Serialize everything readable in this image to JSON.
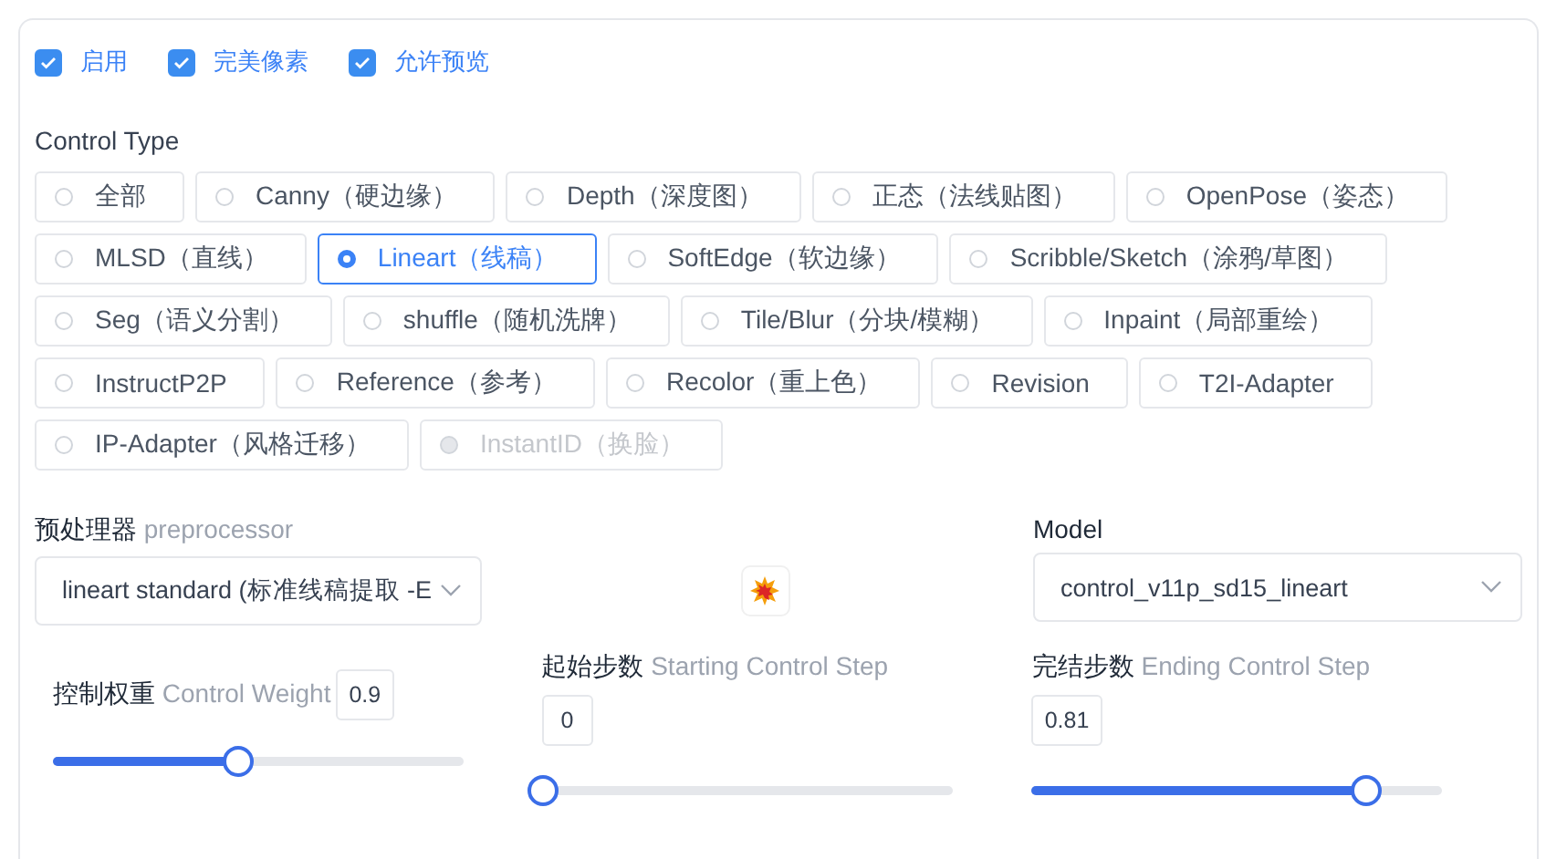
{
  "checkboxes": [
    {
      "label": "启用",
      "checked": true
    },
    {
      "label": "完美像素",
      "checked": true
    },
    {
      "label": "允许预览",
      "checked": true
    }
  ],
  "control_type": {
    "label": "Control Type",
    "rows": [
      [
        {
          "label": "全部",
          "selected": false,
          "disabled": false
        },
        {
          "label": "Canny（硬边缘）",
          "selected": false,
          "disabled": false
        },
        {
          "label": "Depth（深度图）",
          "selected": false,
          "disabled": false
        },
        {
          "label": "正态（法线贴图）",
          "selected": false,
          "disabled": false
        },
        {
          "label": "OpenPose（姿态）",
          "selected": false,
          "disabled": false
        }
      ],
      [
        {
          "label": "MLSD（直线）",
          "selected": false,
          "disabled": false
        },
        {
          "label": "Lineart（线稿）",
          "selected": true,
          "disabled": false
        },
        {
          "label": "SoftEdge（软边缘）",
          "selected": false,
          "disabled": false
        },
        {
          "label": "Scribble/Sketch（涂鸦/草图）",
          "selected": false,
          "disabled": false
        }
      ],
      [
        {
          "label": "Seg（语义分割）",
          "selected": false,
          "disabled": false
        },
        {
          "label": "shuffle（随机洗牌）",
          "selected": false,
          "disabled": false
        },
        {
          "label": "Tile/Blur（分块/模糊）",
          "selected": false,
          "disabled": false
        },
        {
          "label": "Inpaint（局部重绘）",
          "selected": false,
          "disabled": false
        }
      ],
      [
        {
          "label": "InstructP2P",
          "selected": false,
          "disabled": false
        },
        {
          "label": "Reference（参考）",
          "selected": false,
          "disabled": false
        },
        {
          "label": "Recolor（重上色）",
          "selected": false,
          "disabled": false
        },
        {
          "label": "Revision",
          "selected": false,
          "disabled": false
        },
        {
          "label": "T2I-Adapter",
          "selected": false,
          "disabled": false
        }
      ],
      [
        {
          "label": "IP-Adapter（风格迁移）",
          "selected": false,
          "disabled": false
        },
        {
          "label": "InstantID（换脸）",
          "selected": false,
          "disabled": true
        }
      ]
    ]
  },
  "preprocessor": {
    "label_cn": "预处理器",
    "label_en": "preprocessor",
    "value": "lineart standard (标准线稿提取 -E"
  },
  "model": {
    "label": "Model",
    "value": "control_v11p_sd15_lineart"
  },
  "sliders": [
    {
      "label_cn": "控制权重",
      "label_en": "Control Weight",
      "value": "0.9",
      "level": 0.45,
      "kind": "inline"
    },
    {
      "label_cn": "起始步数",
      "label_en": "Starting Control Step",
      "value": "0",
      "level": 0,
      "kind": "below"
    },
    {
      "label_cn": "完结步数",
      "label_en": "Ending Control Step",
      "value": "0.81",
      "level": 0.81,
      "kind": "below"
    }
  ]
}
